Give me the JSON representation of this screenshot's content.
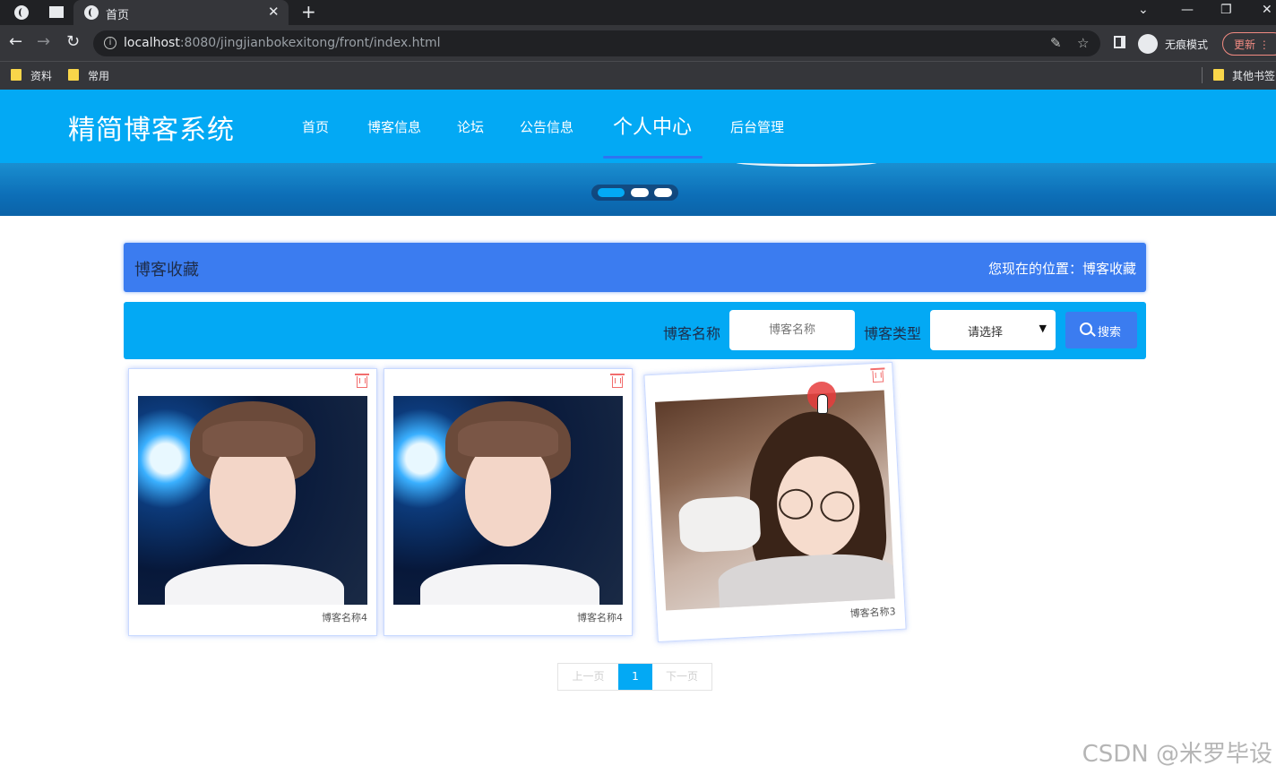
{
  "browser": {
    "tab_title": "首页",
    "url_host": "localhost",
    "url_rest": ":8080/jingjianbokexitong/front/index.html",
    "incognito_label": "无痕模式",
    "update_label": "更新",
    "bookmarks": [
      "资料",
      "常用"
    ],
    "other_bookmarks": "其他书签"
  },
  "site": {
    "logo": "精简博客系统",
    "nav": [
      "首页",
      "博客信息",
      "论坛",
      "公告信息",
      "个人中心",
      "后台管理"
    ],
    "active_nav": "个人中心"
  },
  "page": {
    "title": "博客收藏",
    "breadcrumb": "您现在的位置：博客收藏"
  },
  "search": {
    "name_label": "博客名称",
    "name_placeholder": "博客名称",
    "type_label": "博客类型",
    "type_selected": "请选择",
    "button_label": "搜索"
  },
  "cards": [
    {
      "name": "博客名称4"
    },
    {
      "name": "博客名称4"
    },
    {
      "name": "博客名称3"
    }
  ],
  "pagination": {
    "prev": "上一页",
    "current": "1",
    "next": "下一页"
  },
  "watermark": "CSDN @米罗毕设",
  "colors": {
    "primary": "#03a9f4",
    "accent_blue": "#3b7cf0",
    "delete_red": "#f26d6d"
  }
}
